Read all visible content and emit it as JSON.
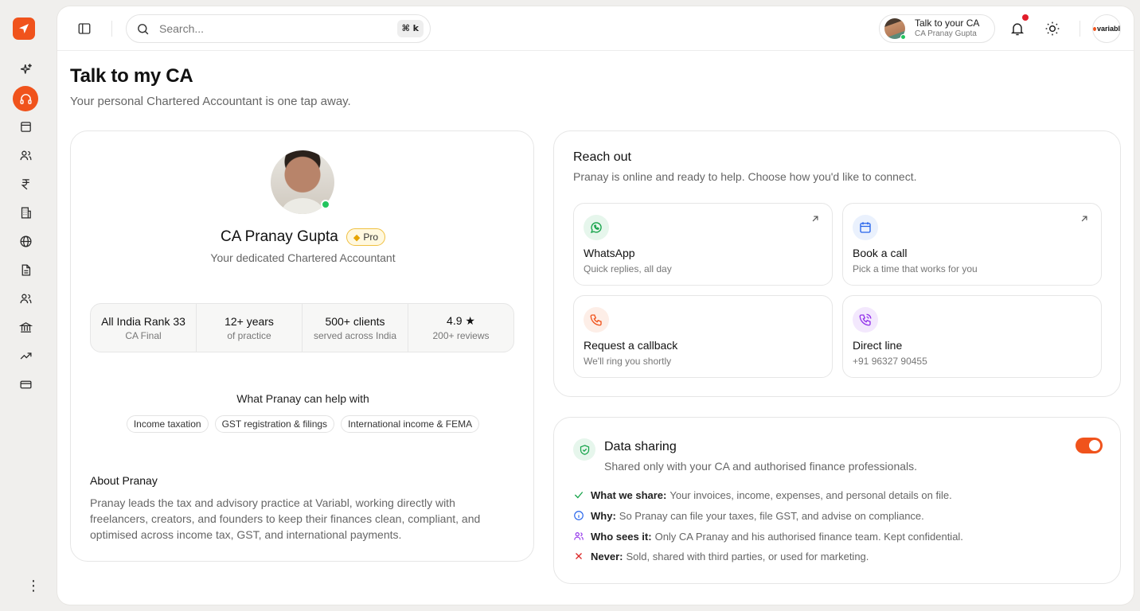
{
  "nav": {
    "items": [
      "sparkle",
      "headphones",
      "wallet",
      "users",
      "rupee",
      "building",
      "globe",
      "document",
      "team",
      "bank",
      "trending",
      "card"
    ],
    "more": "⋮"
  },
  "topbar": {
    "search_placeholder": "Search...",
    "shortcut": "⌘ k",
    "ca_pill_title": "Talk to your CA",
    "ca_pill_sub": "CA Pranay Gupta",
    "brand": "variabl"
  },
  "page": {
    "title": "Talk to my CA",
    "subtitle": "Your personal Chartered Accountant is one tap away."
  },
  "profile": {
    "name": "CA Pranay Gupta",
    "badge": "Pro",
    "role": "Your dedicated Chartered Accountant",
    "stats": [
      {
        "value": "All India Rank 33",
        "label": "CA Final"
      },
      {
        "value": "12+ years",
        "label": "of practice"
      },
      {
        "value": "500+ clients",
        "label": "served across India"
      },
      {
        "value": "4.9 ★",
        "label": "200+ reviews"
      }
    ],
    "help_title": "What Pranay can help with",
    "tags": [
      "Income taxation",
      "GST registration & filings",
      "International income & FEMA"
    ],
    "about_title": "About Pranay",
    "about_text": "Pranay leads the tax and advisory practice at Variabl, working directly with freelancers, creators, and founders to keep their finances clean, compliant, and optimised across income tax, GST, and international payments."
  },
  "reach": {
    "title": "Reach out",
    "subtitle": "Pranay is online and ready to help. Choose how you'd like to connect.",
    "options": [
      {
        "title": "WhatsApp",
        "sub": "Quick replies, all day",
        "icon": "whatsapp-icon",
        "color": "#16a34a"
      },
      {
        "title": "Book a call",
        "sub": "Pick a time that works for you",
        "icon": "calendar-icon",
        "color": "#2563eb"
      },
      {
        "title": "Request a callback",
        "sub": "We'll ring you shortly",
        "icon": "phone-icon",
        "color": "#f0531c"
      },
      {
        "title": "Direct line",
        "sub": "+91 96327 90455",
        "icon": "phone-call-icon",
        "color": "#9333ea"
      }
    ]
  },
  "data_sharing": {
    "title": "Data sharing",
    "subtitle": "Shared only with your CA and authorised finance professionals.",
    "enabled": true,
    "rows": [
      {
        "label": "What we share:",
        "text": "Your invoices, income, expenses, and personal details on file."
      },
      {
        "label": "Why:",
        "text": "So Pranay can file your taxes, file GST, and advise on compliance."
      },
      {
        "label": "Who sees it:",
        "text": "Only CA Pranay and his authorised finance team. Kept confidential."
      },
      {
        "label": "Never:",
        "text": "Sold, shared with third parties, or used for marketing."
      }
    ]
  }
}
